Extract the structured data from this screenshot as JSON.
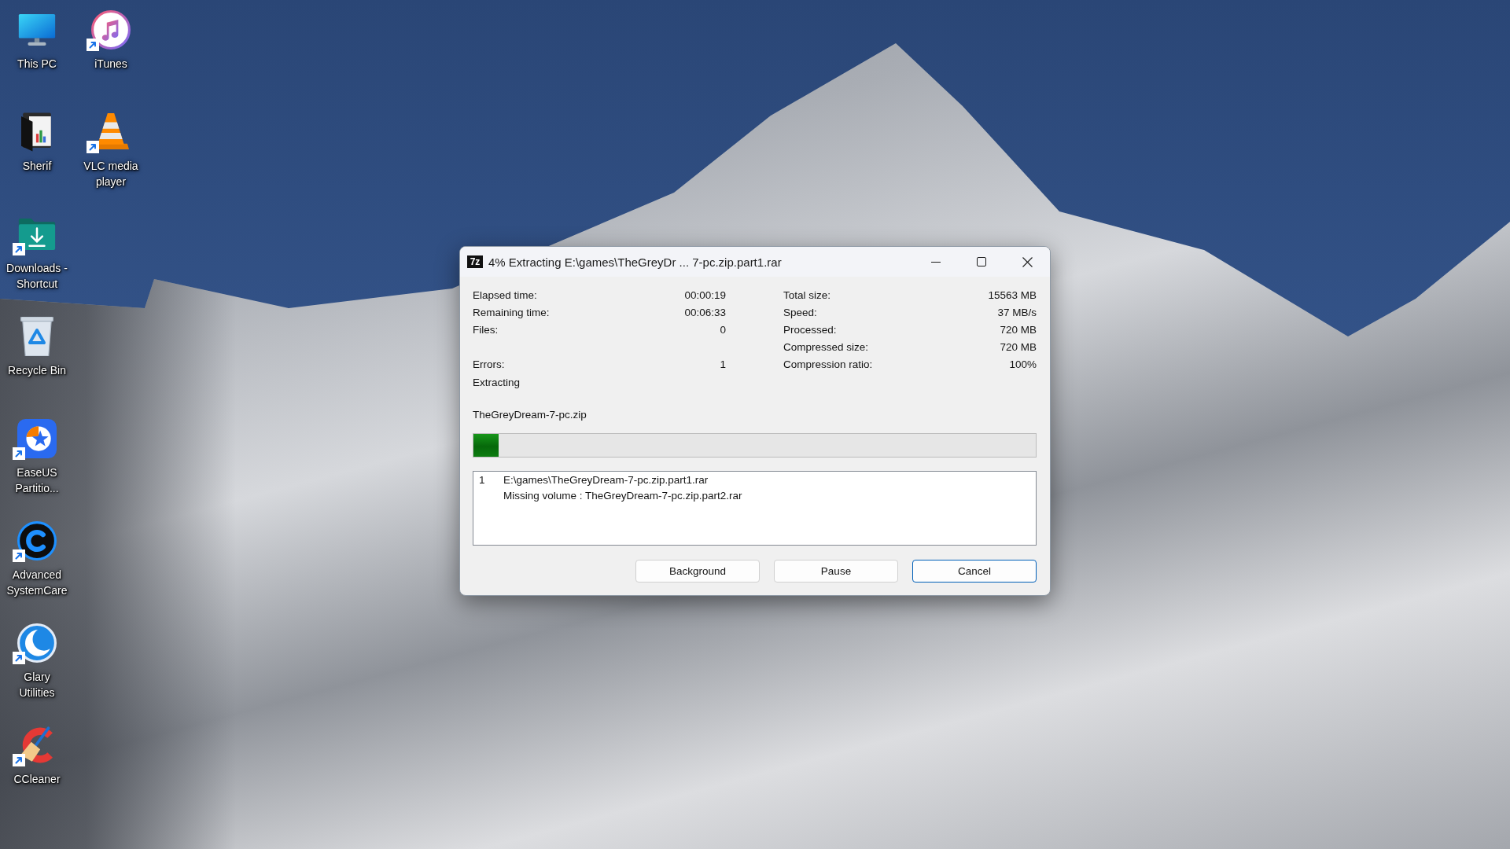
{
  "desktop": {
    "icons": [
      {
        "label": "This PC",
        "kind": "monitor",
        "shortcut": false
      },
      {
        "label": "Sherif",
        "kind": "folder",
        "shortcut": false
      },
      {
        "label": "Downloads - Shortcut",
        "kind": "download",
        "shortcut": true
      },
      {
        "label": "Recycle Bin",
        "kind": "recycle",
        "shortcut": false
      },
      {
        "label": "EaseUS Partitio...",
        "kind": "star",
        "shortcut": true
      },
      {
        "label": "Advanced SystemCare",
        "kind": "ring",
        "shortcut": true
      },
      {
        "label": "Glary Utilities",
        "kind": "crescent",
        "shortcut": true
      },
      {
        "label": "CCleaner",
        "kind": "broom",
        "shortcut": true
      },
      {
        "label": "iTunes",
        "kind": "music",
        "shortcut": true
      },
      {
        "label": "VLC media player",
        "kind": "cone",
        "shortcut": true
      }
    ]
  },
  "dialog": {
    "logo": "7z",
    "title": "4% Extracting E:\\games\\TheGreyDr ... 7-pc.zip.part1.rar",
    "stats": [
      {
        "left": {
          "label": "Elapsed time:",
          "value": "00:00:19"
        },
        "right": {
          "label": "Total size:",
          "value": "15563 MB"
        }
      },
      {
        "left": {
          "label": "Remaining time:",
          "value": "00:06:33"
        },
        "right": {
          "label": "Speed:",
          "value": "37 MB/s"
        }
      },
      {
        "left": {
          "label": "Files:",
          "value": "0"
        },
        "right": {
          "label": "Processed:",
          "value": "720 MB"
        }
      },
      {
        "right": {
          "label": "Compressed size:",
          "value": "720 MB"
        }
      },
      {
        "left": {
          "label": "Errors:",
          "value": "1"
        },
        "right": {
          "label": "Compression ratio:",
          "value": "100%"
        }
      }
    ],
    "status": "Extracting",
    "current_file": "TheGreyDream-7-pc.zip",
    "progress": {
      "level": 0.045
    },
    "messages": [
      {
        "number": "1",
        "lines": [
          "E:\\games\\TheGreyDream-7-pc.zip.part1.rar",
          "Missing volume : TheGreyDream-7-pc.zip.part2.rar"
        ]
      }
    ],
    "buttons": [
      {
        "label": "Background",
        "default": false
      },
      {
        "label": "Pause",
        "default": false
      },
      {
        "label": "Cancel",
        "default": true
      }
    ]
  }
}
